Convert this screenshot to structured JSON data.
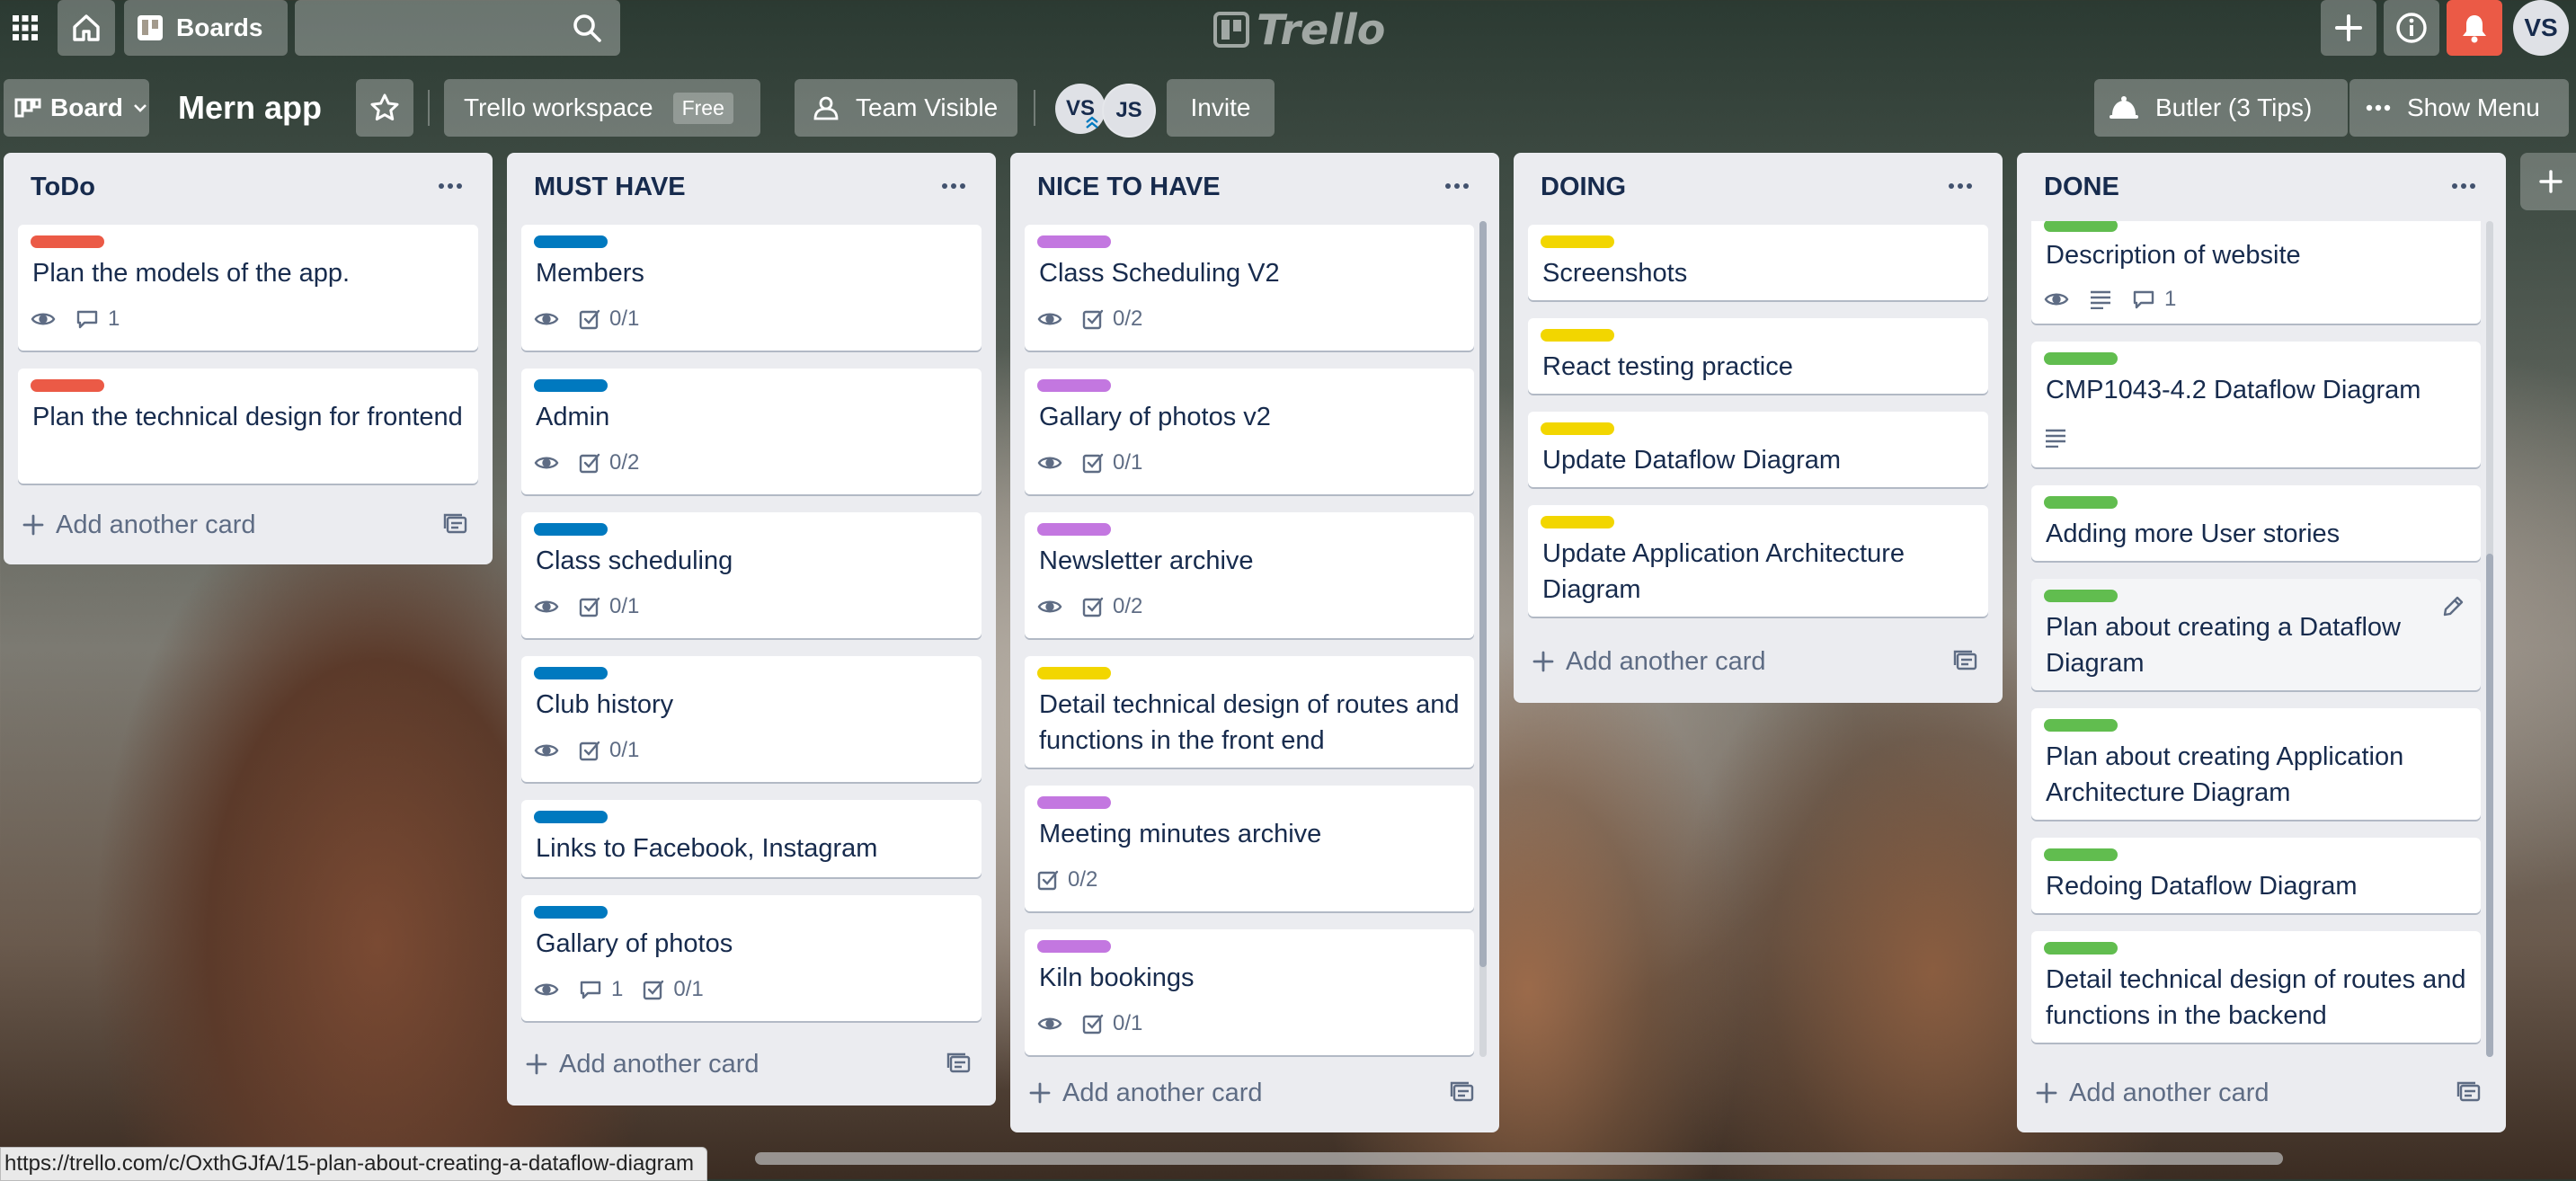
{
  "topbar": {
    "boards_label": "Boards",
    "search_placeholder": "",
    "logo_text": "Trello",
    "user_initials": "VS"
  },
  "board": {
    "view_label": "Board",
    "title": "Mern app",
    "workspace_name": "Trello workspace",
    "workspace_plan": "Free",
    "visibility_label": "Team Visible",
    "members": [
      "VS",
      "JS"
    ],
    "invite_label": "Invite",
    "butler_label": "Butler (3 Tips)",
    "show_menu_label": "Show Menu"
  },
  "add_card_label": "Add another card",
  "lists": [
    {
      "title": "ToDo",
      "cards": [
        {
          "title": "Plan the models of the app.",
          "label_color": "#eb5a46",
          "watch": true,
          "comments": "1"
        },
        {
          "title": "Plan the technical design for frontend",
          "label_color": "#eb5a46"
        }
      ]
    },
    {
      "title": "MUST HAVE",
      "cards": [
        {
          "title": "Members",
          "label_color": "#0079bf",
          "watch": true,
          "checklist": "0/1"
        },
        {
          "title": "Admin",
          "label_color": "#0079bf",
          "watch": true,
          "checklist": "0/2"
        },
        {
          "title": "Class scheduling",
          "label_color": "#0079bf",
          "watch": true,
          "checklist": "0/1"
        },
        {
          "title": "Club history",
          "label_color": "#0079bf",
          "watch": true,
          "checklist": "0/1"
        },
        {
          "title": "Links to Facebook, Instagram",
          "label_color": "#0079bf"
        },
        {
          "title": "Gallary of photos",
          "label_color": "#0079bf",
          "watch": true,
          "comments": "1",
          "checklist": "0/1"
        }
      ]
    },
    {
      "title": "NICE TO HAVE",
      "cards": [
        {
          "title": "Class Scheduling V2",
          "label_color": "#c377e0",
          "watch": true,
          "checklist": "0/2"
        },
        {
          "title": "Gallary of photos v2",
          "label_color": "#c377e0",
          "watch": true,
          "checklist": "0/1"
        },
        {
          "title": "Newsletter archive",
          "label_color": "#c377e0",
          "watch": true,
          "checklist": "0/2"
        },
        {
          "title": "Detail technical design of routes and functions in the front end",
          "label_color": "#f2d600"
        },
        {
          "title": "Meeting minutes archive",
          "label_color": "#c377e0",
          "checklist": "0/2"
        },
        {
          "title": "Kiln bookings",
          "label_color": "#c377e0",
          "watch": true,
          "checklist": "0/1"
        }
      ]
    },
    {
      "title": "DOING",
      "cards": [
        {
          "title": "Screenshots",
          "label_color": "#f2d600"
        },
        {
          "title": "React testing practice",
          "label_color": "#f2d600"
        },
        {
          "title": "Update Dataflow Diagram",
          "label_color": "#f2d600"
        },
        {
          "title": "Update Application Architecture Diagram",
          "label_color": "#f2d600"
        }
      ]
    },
    {
      "title": "DONE",
      "cards": [
        {
          "title": "Description of website",
          "label_color": "#61bd4f",
          "watch": true,
          "description": true,
          "comments": "1"
        },
        {
          "title": "CMP1043-4.2 Dataflow Diagram",
          "label_color": "#61bd4f",
          "description": true
        },
        {
          "title": "Adding more User stories",
          "label_color": "#61bd4f"
        },
        {
          "title": "Plan about creating a Dataflow Diagram",
          "label_color": "#61bd4f"
        },
        {
          "title": "Plan about creating Application Architecture Diagram",
          "label_color": "#61bd4f"
        },
        {
          "title": "Redoing Dataflow Diagram",
          "label_color": "#61bd4f"
        },
        {
          "title": "Detail technical design of routes and functions in the backend",
          "label_color": "#61bd4f"
        }
      ]
    }
  ],
  "status_url": "https://trello.com/c/OxthGJfA/15-plan-about-creating-a-dataflow-diagram"
}
